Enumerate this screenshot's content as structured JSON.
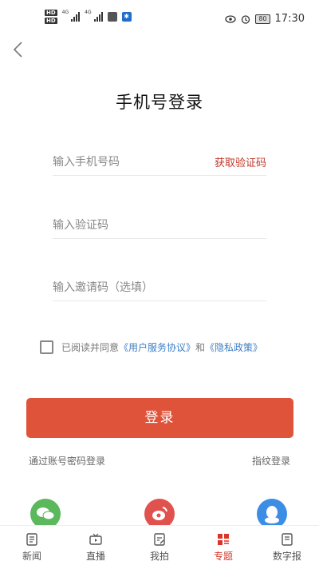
{
  "status_bar": {
    "network_left": "4G",
    "network_right": "4G",
    "battery": "80",
    "time": "17:30"
  },
  "header": {
    "title": "手机号登录"
  },
  "form": {
    "phone_placeholder": "输入手机号码",
    "get_code_label": "获取验证码",
    "code_placeholder": "输入验证码",
    "invite_placeholder": "输入邀请码（选填）"
  },
  "agreement": {
    "prefix": "已阅读并同意",
    "user_agreement": "《用户服务协议》",
    "conjunction": "和",
    "privacy_policy": "《隐私政策》"
  },
  "login_button": "登录",
  "alt_login": {
    "account_password": "通过账号密码登录",
    "fingerprint": "指纹登录"
  },
  "social": [
    "wechat-icon",
    "weibo-icon",
    "qq-icon"
  ],
  "tabs": [
    {
      "label": "新闻",
      "active": false
    },
    {
      "label": "直播",
      "active": false
    },
    {
      "label": "我拍",
      "active": false
    },
    {
      "label": "专题",
      "active": true
    },
    {
      "label": "数字报",
      "active": false
    }
  ],
  "colors": {
    "accent": "#e0533b",
    "link": "#3d7fc6",
    "active_tab": "#d9352a"
  }
}
